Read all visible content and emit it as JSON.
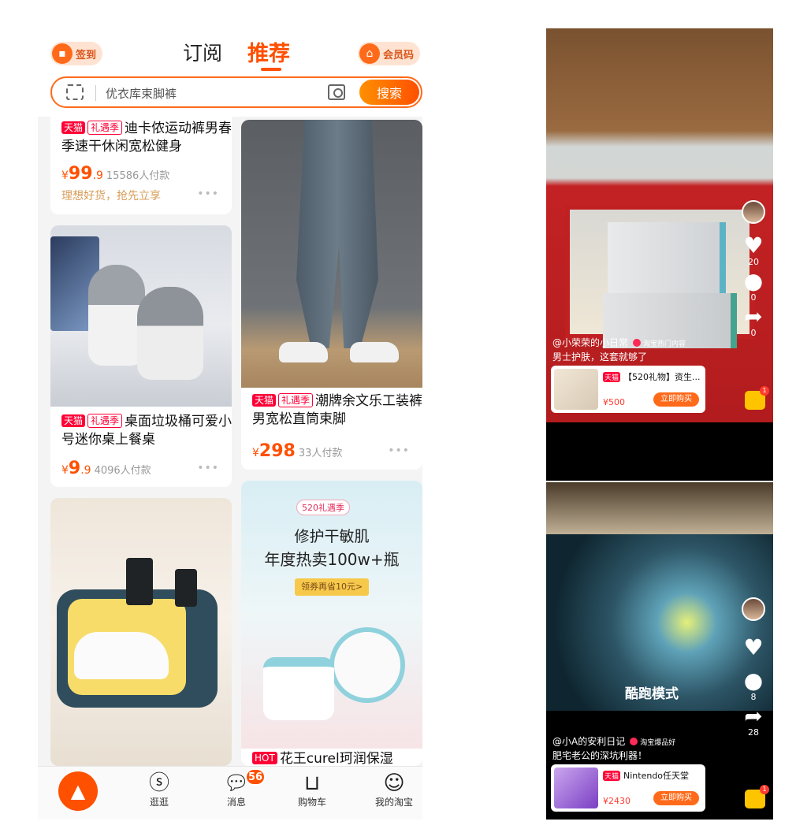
{
  "left": {
    "signin_label": "签到",
    "member_label": "会员码",
    "tabs": [
      "订阅",
      "推荐"
    ],
    "search_placeholder": "优衣库束脚裤",
    "search_button": "搜索",
    "cards": [
      {
        "tags": [
          "天猫",
          "礼遇季"
        ],
        "title": "迪卡侬运动裤男春季速干休闲宽松健身",
        "price_symbol": "¥",
        "price_int": "99",
        "price_dec": ".9",
        "paid": "15586人付款",
        "slogan": "理想好货，抢先立享",
        "more": "•••"
      },
      {
        "tags": [
          "天猫",
          "礼遇季"
        ],
        "title": "潮牌余文乐工装裤男宽松直筒束脚",
        "price_symbol": "¥",
        "price_int": "298",
        "price_dec": "",
        "paid": "33人付款",
        "more": "•••"
      },
      {
        "tags": [
          "天猫",
          "礼遇季"
        ],
        "title": "桌面垃圾桶可爱小号迷你桌上餐桌",
        "price_symbol": "¥",
        "price_int": "9",
        "price_dec": ".9",
        "paid": "4096人付款",
        "more": "•••"
      },
      {
        "tags": [
          "HOT"
        ],
        "title": "花王curel珂润保湿",
        "ad_badge": "520礼遇季",
        "ad_line1": "修护干敏肌",
        "ad_line2": "年度热卖100w+瓶",
        "ad_coupon": "领券再省10元>"
      }
    ],
    "nav": [
      {
        "label": "",
        "icon": "home-rocket-icon"
      },
      {
        "label": "逛逛",
        "icon": "stroll-icon"
      },
      {
        "label": "消息",
        "icon": "message-icon",
        "badge": "56"
      },
      {
        "label": "购物车",
        "icon": "cart-icon"
      },
      {
        "label": "我的淘宝",
        "icon": "profile-icon"
      }
    ]
  },
  "right": {
    "videos": [
      {
        "author": "@小荣荣的小日常",
        "hot": "淘宝热门内容",
        "caption": "男士护肤，这套就够了",
        "like_count": "20",
        "comment_count": "0",
        "share_count": "0",
        "product_tag": "天猫",
        "product_title": "【520礼物】资生...",
        "product_price": "¥500",
        "buy": "立即购买"
      },
      {
        "author": "@小A的安利日记",
        "hot": "淘宝爆品好",
        "caption": "肥宅老公的深坑利器！",
        "overlay_text": "酷跑模式",
        "comment_count": "8",
        "share_count": "28",
        "product_tag": "天猫",
        "product_title": "Nintendo任天堂",
        "product_price": "¥2430",
        "buy": "立即购买"
      }
    ]
  },
  "colors": {
    "accent": "#ff5000",
    "tmall_red": "#ff0036"
  }
}
